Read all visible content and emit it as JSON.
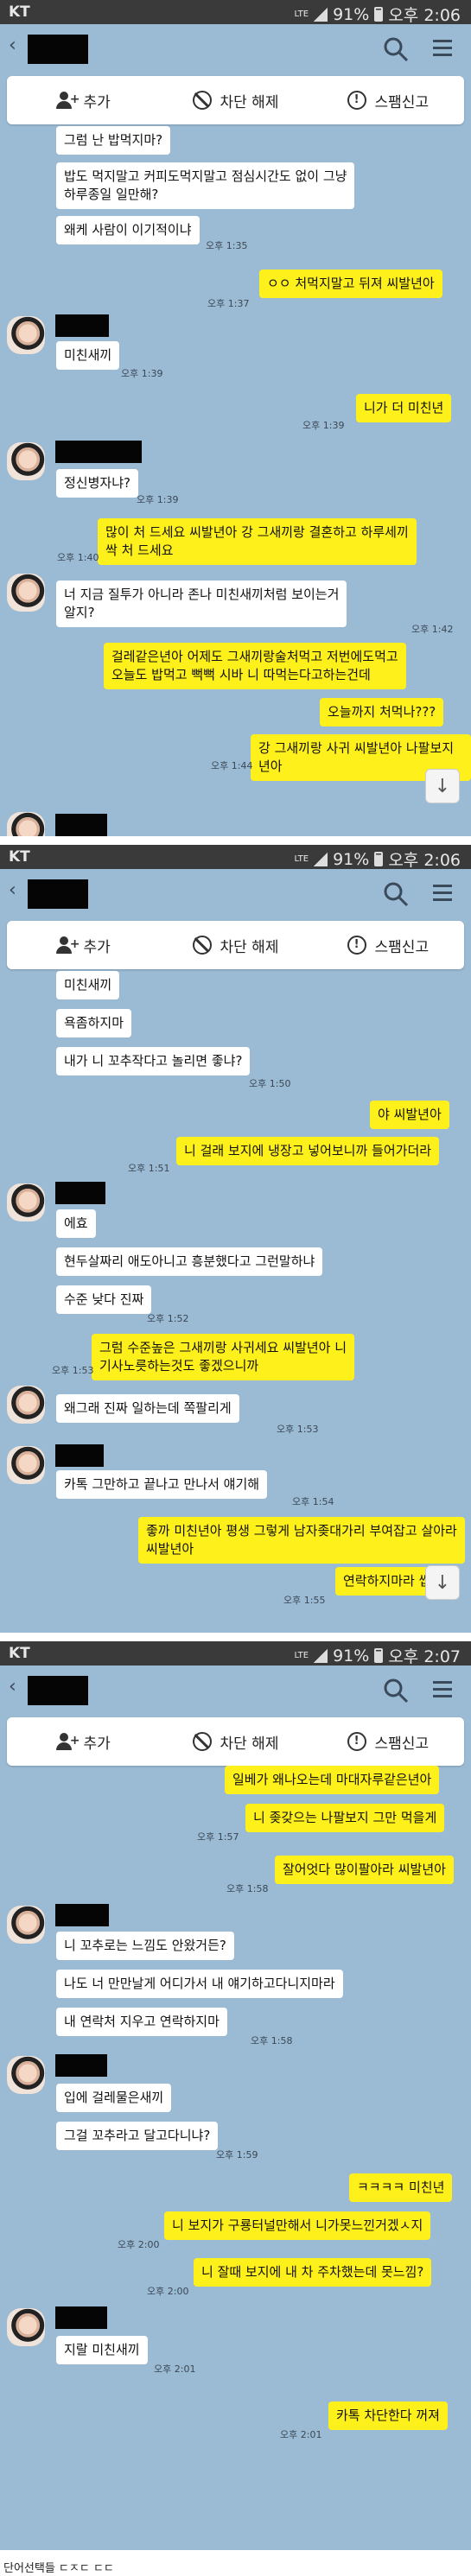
{
  "status": {
    "carrier": "KT",
    "network": "LTE",
    "battery": "91%"
  },
  "actions": {
    "add": "추가",
    "unblock": "차단 해제",
    "report": "스팸신고"
  },
  "screens": [
    {
      "time": "오후 2:06"
    },
    {
      "time": "오후 2:06"
    },
    {
      "time": "오후 2:07"
    }
  ],
  "s1": {
    "m1": "그럼 난 밥먹지마?",
    "m2": "밥도 먹지말고 커피도먹지말고 점심시간도 없이 그냥\n하루종일 일만해?",
    "m3": "왜케 사람이 이기적이냐",
    "t1": "오후 1:35",
    "t2": "오후 1:37",
    "o1": "ㅇㅇ 처먹지말고 뒤져 씨발년아",
    "m4": "미친새끼",
    "t3": "오후 1:39",
    "o2": "니가 더 미친년",
    "t4": "오후 1:39",
    "m5": "정신병자냐?",
    "t5": "오후 1:39",
    "o3": "많이 처 드세요 씨발년아 강 그새끼랑 결혼하고 하루세끼\n싹 처 드세요",
    "t6": "오후 1:40",
    "m6": "너 지금 질투가 아니라 존나 미친새끼처럼 보이는거\n알지?",
    "t7": "오후 1:42",
    "o4": "걸레같은년아 어제도 그새끼랑술처먹고 저번에도먹고\n오늘도 밥먹고 뻑뻑 시바 니 따먹는다고하는건데",
    "o5": "오늘까지 처먹나???",
    "o6": "강 그새끼랑 사귀 씨발년아 나팔보지년아",
    "t8": "오후 1:44"
  },
  "s2": {
    "m1": "미친새끼",
    "m2": "욕좀하지마",
    "m3": "내가 니 꼬추작다고 놀리면 좋냐?",
    "t1": "오후 1:50",
    "o1": "야 씨발년아",
    "o2": "니 걸래 보지에 냉장고 넣어보니까 들어가더라",
    "t2": "오후 1:51",
    "m4": "에효",
    "m5": "현두살짜리 애도아니고 흥분했다고 그런말하냐",
    "m6": "수준 낮다 진짜",
    "t3": "오후 1:52",
    "o3": "그럼 수준높은 그새끼랑 사귀세요 씨발년아 니\n기사노릇하는것도 좋겠으니까",
    "t4": "오후 1:53",
    "m7": "왜그래 진짜 일하는데 쪽팔리게",
    "t5": "오후 1:53",
    "m8": "카톡 그만하고 끝나고 만나서 얘기해",
    "t6": "오후 1:54",
    "o4": "좋까 미친년아 평생 그렇게 남자좆대가리 부여잡고 살아라\n씨발년아",
    "o5": "연락하지마라 씹",
    "t7": "오후 1:55"
  },
  "s3": {
    "o1": "일베가 왜나오는데 마대자루같은년아",
    "o2": "니 좆갖으는 나팔보지 그만 먹을게",
    "t1": "오후 1:57",
    "o3": "잘어엇다 많이팔아라 씨발년아",
    "t2": "오후 1:58",
    "m1": "니 꼬추로는 느낌도 안왔거든?",
    "m2": "나도 너 만만날게 어디가서 내 얘기하고다니지마라",
    "m3": "내 연락처 지우고 연락하지마",
    "t3": "오후 1:58",
    "m4": "입에 걸레물은새끼",
    "m5": "그걸 꼬추라고 달고다니냐?",
    "t4": "오후 1:59",
    "o4": "ㅋㅋㅋㅋ 미친년",
    "o5": "니 보지가 구룡터널만해서 니가못느낀거겠ㅅ지",
    "t5": "오후 2:00",
    "o6": "니 잘때 보지에 내 차 주차했는데 못느낌?",
    "t6": "오후 2:00",
    "m6": "지랄 미친새끼",
    "t7": "오후 2:01",
    "o7": "카톡 차단한다 꺼져",
    "t8": "오후 2:01"
  },
  "footer": "단어선택들 ㄷㅈㄷ ㄷㄷ"
}
